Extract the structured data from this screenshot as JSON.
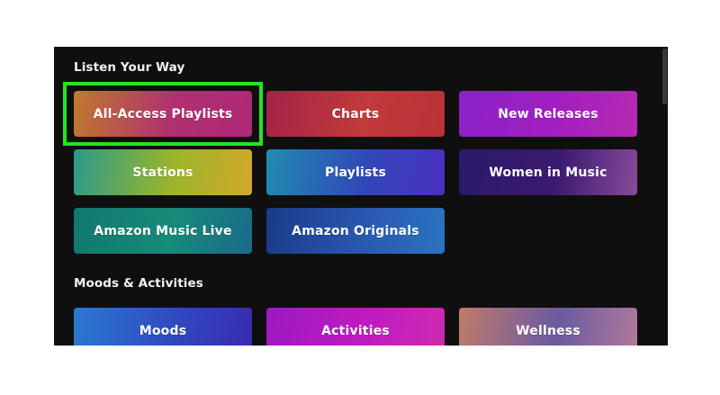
{
  "sections": {
    "listen_your_way": "Listen Your Way",
    "moods_activities": "Moods & Activities"
  },
  "tiles": [
    {
      "label": "All-Access Playlists",
      "colors": [
        "#c07a2c",
        "#b03070",
        "#b02878"
      ]
    },
    {
      "label": "Charts",
      "colors": [
        "#a32348",
        "#c23a3a",
        "#b83236"
      ]
    },
    {
      "label": "New Releases",
      "colors": [
        "#8a22c9",
        "#a31ec0",
        "#b62ab3"
      ]
    },
    {
      "label": "Stations",
      "colors": [
        "#2a9a8a",
        "#9ab52a",
        "#d2a82a"
      ]
    },
    {
      "label": "Playlists",
      "colors": [
        "#1f8cb0",
        "#3148b8",
        "#4b2fc0"
      ]
    },
    {
      "label": "Women in Music",
      "colors": [
        "#2a1a6a",
        "#3a1a70",
        "#8a4a9a"
      ]
    },
    {
      "label": "Amazon Music Live",
      "colors": [
        "#11786e",
        "#178a7a",
        "#1a6a8a"
      ]
    },
    {
      "label": "Amazon Originals",
      "colors": [
        "#1a3a8a",
        "#2a58b0",
        "#2a74c0"
      ]
    },
    {
      "label": "Moods",
      "colors": [
        "#2a7ad0",
        "#2f4ac0",
        "#3a2ab0"
      ]
    },
    {
      "label": "Activities",
      "colors": [
        "#9a1ac0",
        "#c01ac0",
        "#d02ab0"
      ]
    },
    {
      "label": "Wellness",
      "colors": [
        "#c07a6a",
        "#6a5aa0",
        "#b07a9a"
      ]
    }
  ],
  "highlight_color": "#22e522"
}
